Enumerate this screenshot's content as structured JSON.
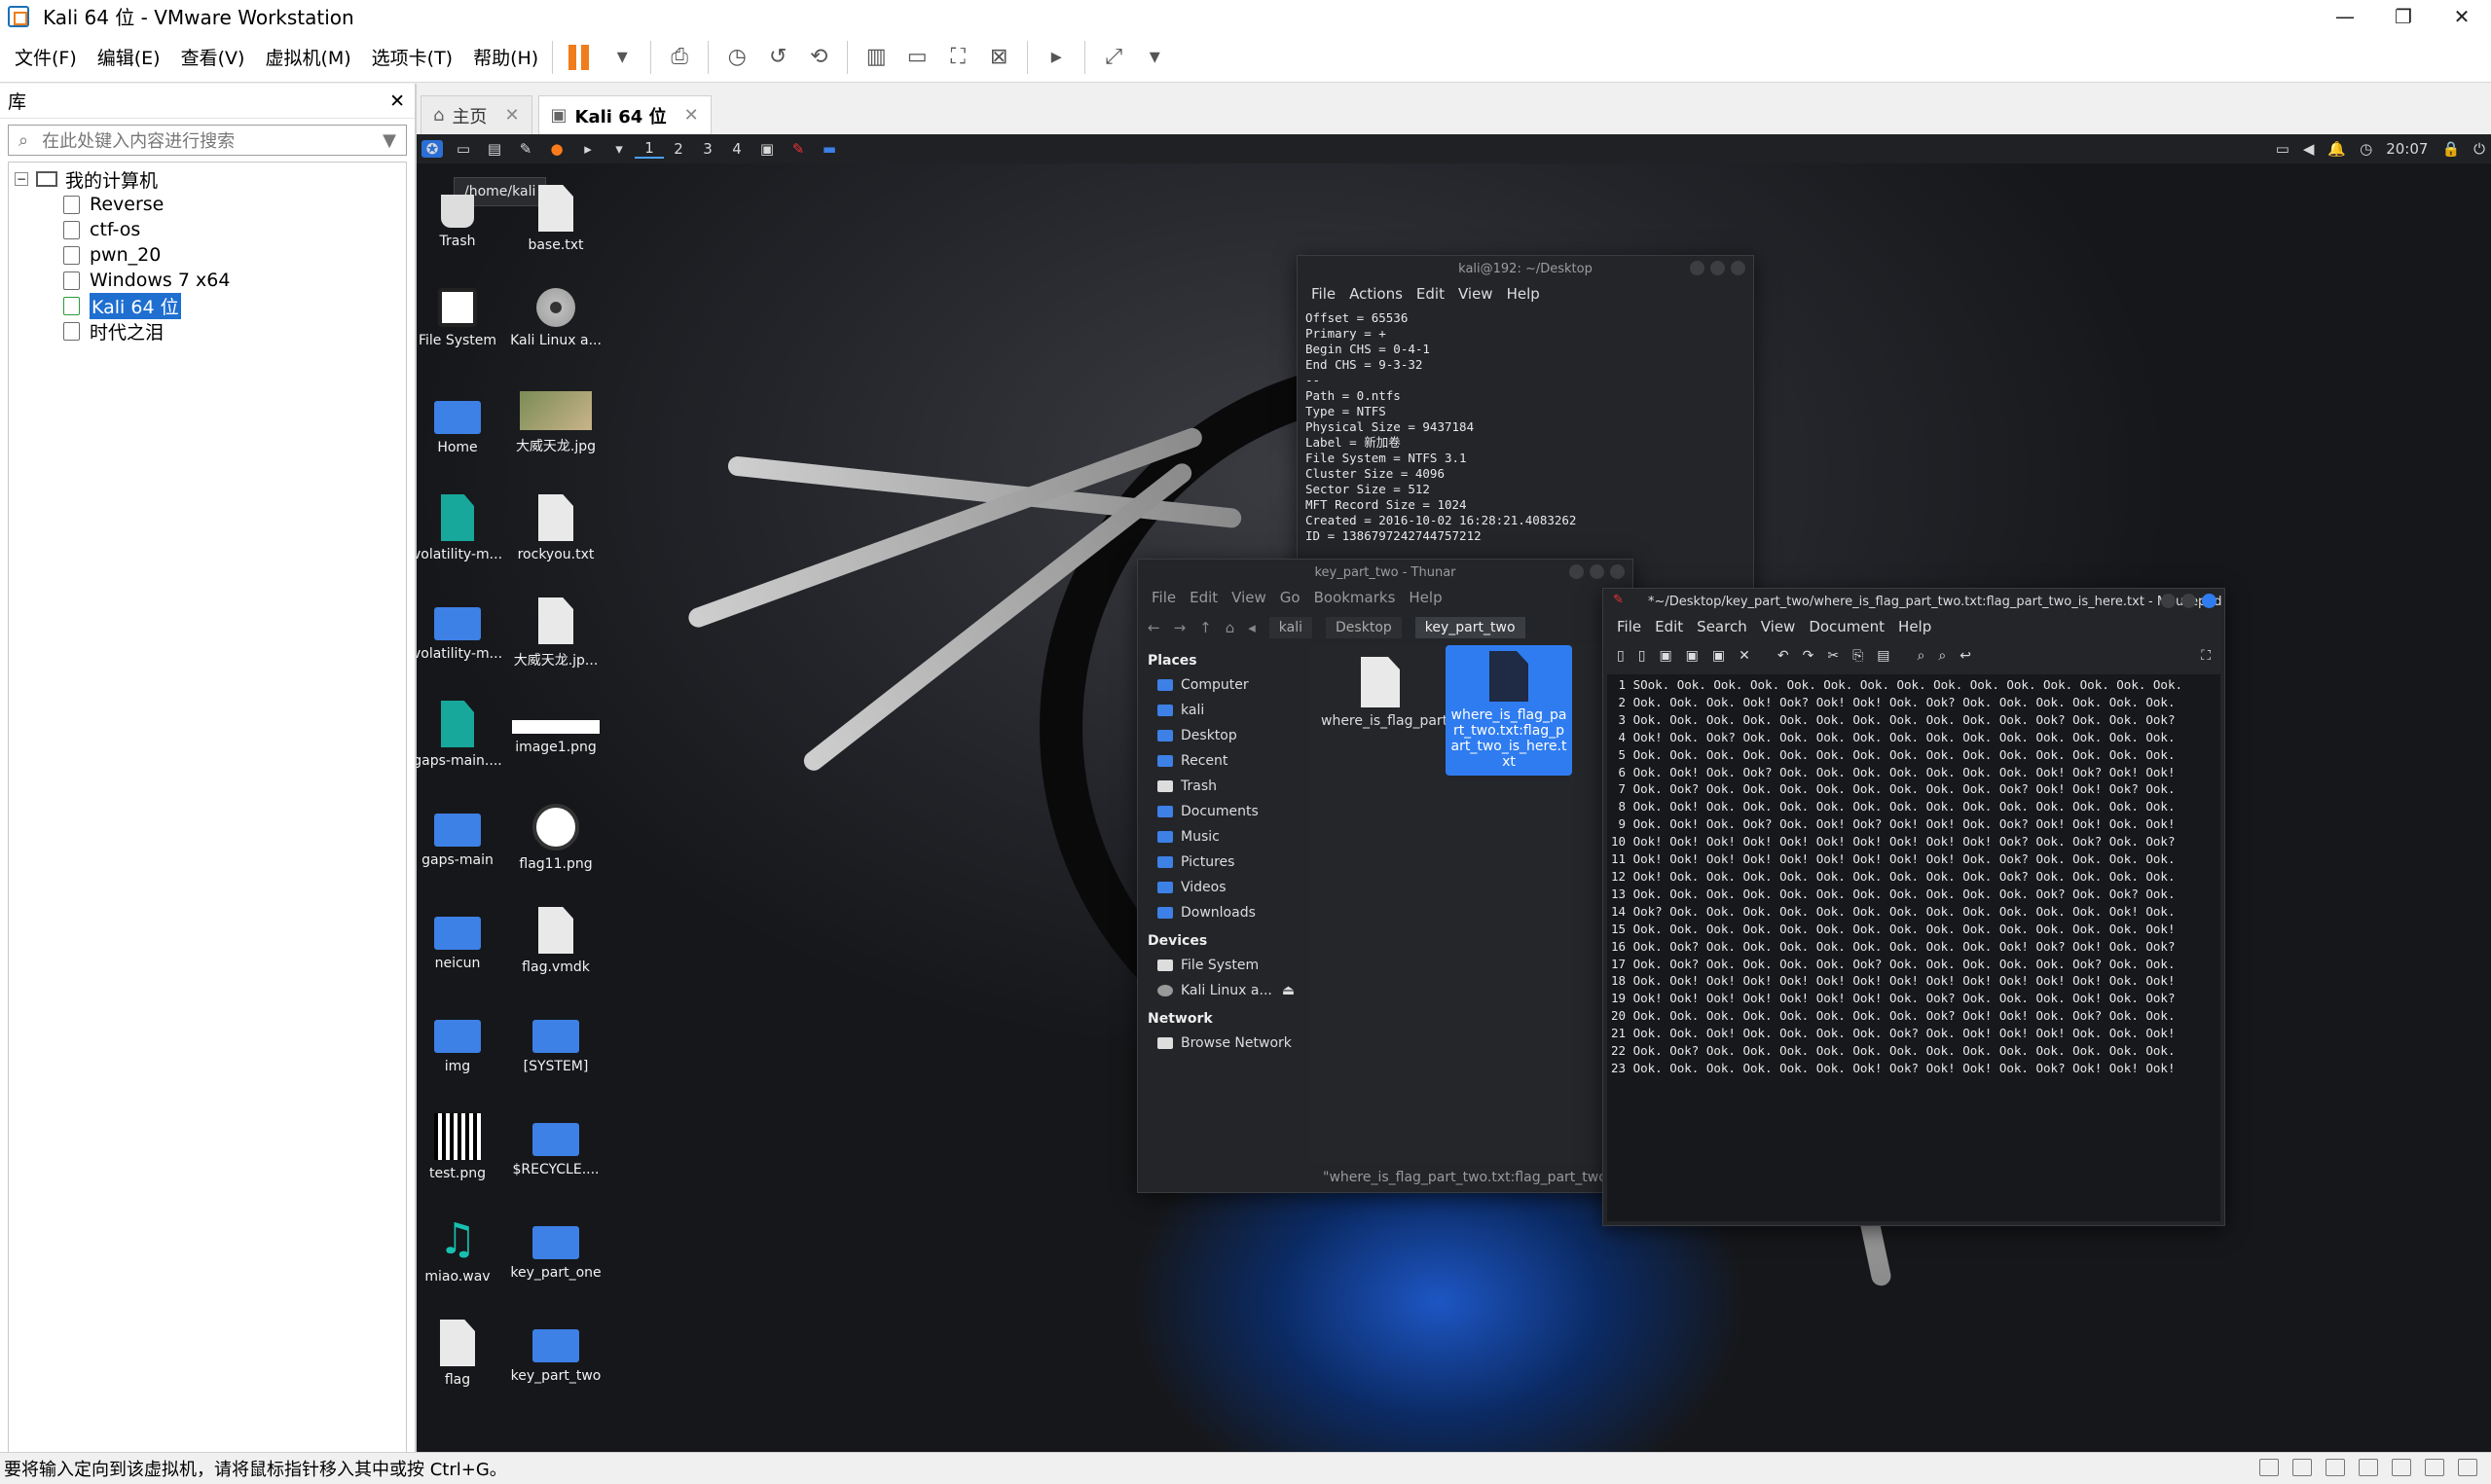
{
  "window": {
    "title": "Kali 64 位 - VMware Workstation",
    "controls": [
      "—",
      "❐",
      "✕"
    ]
  },
  "menu": [
    "文件(F)",
    "编辑(E)",
    "查看(V)",
    "虚拟机(M)",
    "选项卡(T)",
    "帮助(H)"
  ],
  "library": {
    "title": "库",
    "close": "✕",
    "search_placeholder": "在此处键入内容进行搜索",
    "root": "我的计算机",
    "items": [
      "Reverse",
      "ctf-os",
      "pwn_20",
      "Windows 7 x64",
      "Kali 64 位",
      "时代之泪"
    ],
    "selected": "Kali 64 位"
  },
  "tabs": [
    {
      "label": "主页",
      "close": "✕"
    },
    {
      "label": "Kali 64 位",
      "close": "✕"
    }
  ],
  "kali_panel": {
    "workspaces": [
      "1",
      "2",
      "3",
      "4"
    ],
    "clock": "20:07"
  },
  "tooltip": "/home/kali",
  "desktop_icons": [
    "Trash",
    "base.txt",
    "File System",
    "Kali Linux a...",
    "Home",
    "大威天龙.jpg",
    "volatility-m...",
    "rockyou.txt",
    "volatility-m...",
    "大威天龙.jp...",
    "gaps-main....",
    "image1.png",
    "gaps-main",
    "flag11.png",
    "neicun",
    "flag.vmdk",
    "img",
    "[SYSTEM]",
    "test.png",
    "$RECYCLE....",
    "miao.wav",
    "key_part_one",
    "flag",
    "key_part_two"
  ],
  "terminal": {
    "title": "kali@192: ~/Desktop",
    "menu": [
      "File",
      "Actions",
      "Edit",
      "View",
      "Help"
    ],
    "lines": [
      "Offset = 65536",
      "Primary = +",
      "Begin CHS = 0-4-1",
      "End CHS = 9-3-32",
      "--",
      "Path = 0.ntfs",
      "Type = NTFS",
      "Physical Size = 9437184",
      "Label = 新加卷",
      "File System = NTFS 3.1",
      "Cluster Size = 4096",
      "Sector Size = 512",
      "MFT Record Size = 1024",
      "Created = 2016-10-02 16:28:21.4083262",
      "ID = 1386797242744757212"
    ]
  },
  "thunar": {
    "title": "key_part_two - Thunar",
    "menu": [
      "File",
      "Edit",
      "View",
      "Go",
      "Bookmarks",
      "Help"
    ],
    "breadcrumbs": [
      "kali",
      "Desktop",
      "key_part_two"
    ],
    "places_header": "Places",
    "places": [
      "Computer",
      "kali",
      "Desktop",
      "Recent",
      "Trash",
      "Documents",
      "Music",
      "Pictures",
      "Videos",
      "Downloads"
    ],
    "devices_header": "Devices",
    "devices": [
      "File System",
      "Kali Linux a..."
    ],
    "network_header": "Network",
    "network": [
      "Browse Network"
    ],
    "files": [
      "where_is_flag_part_two.txt",
      "where_is_flag_part_two.txt:flag_part_two_is_here.txt"
    ],
    "status": "\"where_is_flag_part_two.txt:flag_part_two_is_here.txt\""
  },
  "mousepad": {
    "title": "*~/Desktop/key_part_two/where_is_flag_part_two.txt:flag_part_two_is_here.txt - Mousepad",
    "menu": [
      "File",
      "Edit",
      "Search",
      "View",
      "Document",
      "Help"
    ],
    "lines": [
      " 1 SOok. Ook. Ook. Ook. Ook. Ook. Ook. Ook. Ook. Ook. Ook. Ook. Ook. Ook. Ook.",
      " 2 Ook. Ook. Ook. Ook! Ook? Ook! Ook! Ook. Ook? Ook. Ook. Ook. Ook. Ook. Ook.",
      " 3 Ook. Ook. Ook. Ook. Ook. Ook. Ook. Ook. Ook. Ook. Ook. Ook? Ook. Ook. Ook?",
      " 4 Ook! Ook. Ook? Ook. Ook. Ook. Ook. Ook. Ook. Ook. Ook. Ook. Ook. Ook. Ook.",
      " 5 Ook. Ook. Ook. Ook. Ook. Ook. Ook. Ook. Ook. Ook. Ook. Ook. Ook. Ook. Ook.",
      " 6 Ook. Ook! Ook. Ook? Ook. Ook. Ook. Ook. Ook. Ook. Ook. Ook! Ook? Ook! Ook!",
      " 7 Ook. Ook? Ook. Ook. Ook. Ook. Ook. Ook. Ook. Ook. Ook? Ook! Ook! Ook? Ook.",
      " 8 Ook. Ook! Ook. Ook. Ook. Ook. Ook. Ook. Ook. Ook. Ook. Ook. Ook. Ook. Ook.",
      " 9 Ook. Ook! Ook. Ook? Ook. Ook! Ook? Ook! Ook! Ook. Ook? Ook! Ook! Ook. Ook!",
      "10 Ook! Ook! Ook! Ook! Ook! Ook! Ook! Ook! Ook! Ook! Ook? Ook. Ook? Ook. Ook?",
      "11 Ook! Ook! Ook! Ook! Ook! Ook! Ook! Ook! Ook! Ook. Ook? Ook. Ook. Ook. Ook.",
      "12 Ook! Ook. Ook. Ook. Ook. Ook. Ook. Ook. Ook. Ook. Ook? Ook. Ook. Ook. Ook.",
      "13 Ook. Ook. Ook. Ook. Ook. Ook. Ook. Ook. Ook. Ook. Ook. Ook? Ook. Ook? Ook.",
      "14 Ook? Ook. Ook. Ook. Ook. Ook. Ook. Ook. Ook. Ook. Ook. Ook. Ook. Ook! Ook.",
      "15 Ook. Ook. Ook. Ook. Ook. Ook. Ook. Ook. Ook. Ook. Ook. Ook. Ook. Ook. Ook!",
      "16 Ook. Ook? Ook. Ook. Ook. Ook. Ook. Ook. Ook. Ook. Ook! Ook? Ook! Ook. Ook?",
      "17 Ook. Ook? Ook. Ook. Ook. Ook. Ook? Ook. Ook. Ook. Ook. Ook. Ook? Ook. Ook.",
      "18 Ook. Ook! Ook! Ook! Ook! Ook! Ook! Ook! Ook! Ook! Ook! Ook! Ook! Ook. Ook!",
      "19 Ook! Ook! Ook! Ook! Ook! Ook! Ook! Ook. Ook? Ook. Ook. Ook. Ook! Ook. Ook?",
      "20 Ook. Ook. Ook. Ook. Ook. Ook. Ook. Ook. Ook? Ook! Ook! Ook. Ook? Ook. Ook.",
      "21 Ook. Ook. Ook! Ook. Ook. Ook. Ook. Ook? Ook. Ook! Ook! Ook! Ook. Ook. Ook!",
      "22 Ook. Ook? Ook. Ook. Ook. Ook. Ook. Ook. Ook. Ook. Ook. Ook. Ook. Ook. Ook.",
      "23 Ook. Ook. Ook. Ook. Ook. Ook. Ook! Ook? Ook! Ook! Ook. Ook? Ook! Ook! Ook!"
    ]
  },
  "statusbar": {
    "text": "要将输入定向到该虚拟机，请将鼠标指针移入其中或按 Ctrl+G。"
  }
}
